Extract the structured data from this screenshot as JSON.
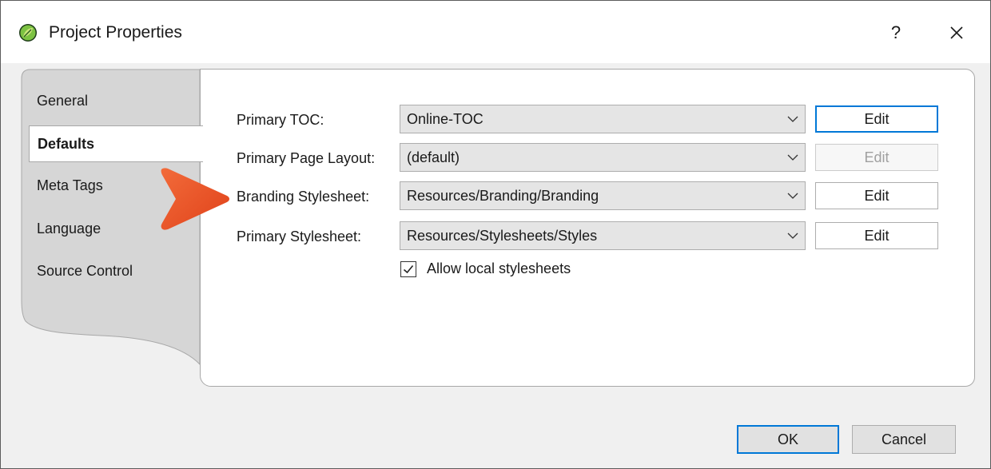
{
  "window": {
    "title": "Project Properties",
    "help_label": "?",
    "icon": "app-leaf-icon",
    "accent_color": "#0078d7"
  },
  "tabs": [
    {
      "label": "General",
      "active": false
    },
    {
      "label": "Defaults",
      "active": true
    },
    {
      "label": "Meta Tags",
      "active": false
    },
    {
      "label": "Language",
      "active": false
    },
    {
      "label": "Source Control",
      "active": false
    }
  ],
  "defaults": {
    "rows": [
      {
        "label": "Primary TOC:",
        "value": "Online-TOC",
        "edit_label": "Edit",
        "edit_enabled": true
      },
      {
        "label": "Primary Page Layout:",
        "value": "(default)",
        "edit_label": "Edit",
        "edit_enabled": false
      },
      {
        "label": "Branding Stylesheet:",
        "value": "Resources/Branding/Branding",
        "edit_label": "Edit",
        "edit_enabled": true
      },
      {
        "label": "Primary Stylesheet:",
        "value": "Resources/Stylesheets/Styles",
        "edit_label": "Edit",
        "edit_enabled": true
      }
    ],
    "allow_local": {
      "label": "Allow local stylesheets",
      "checked": true
    }
  },
  "callout": {
    "icon": "orange-arrow-icon",
    "color": "#ea4a1f"
  },
  "footer": {
    "ok_label": "OK",
    "cancel_label": "Cancel"
  }
}
